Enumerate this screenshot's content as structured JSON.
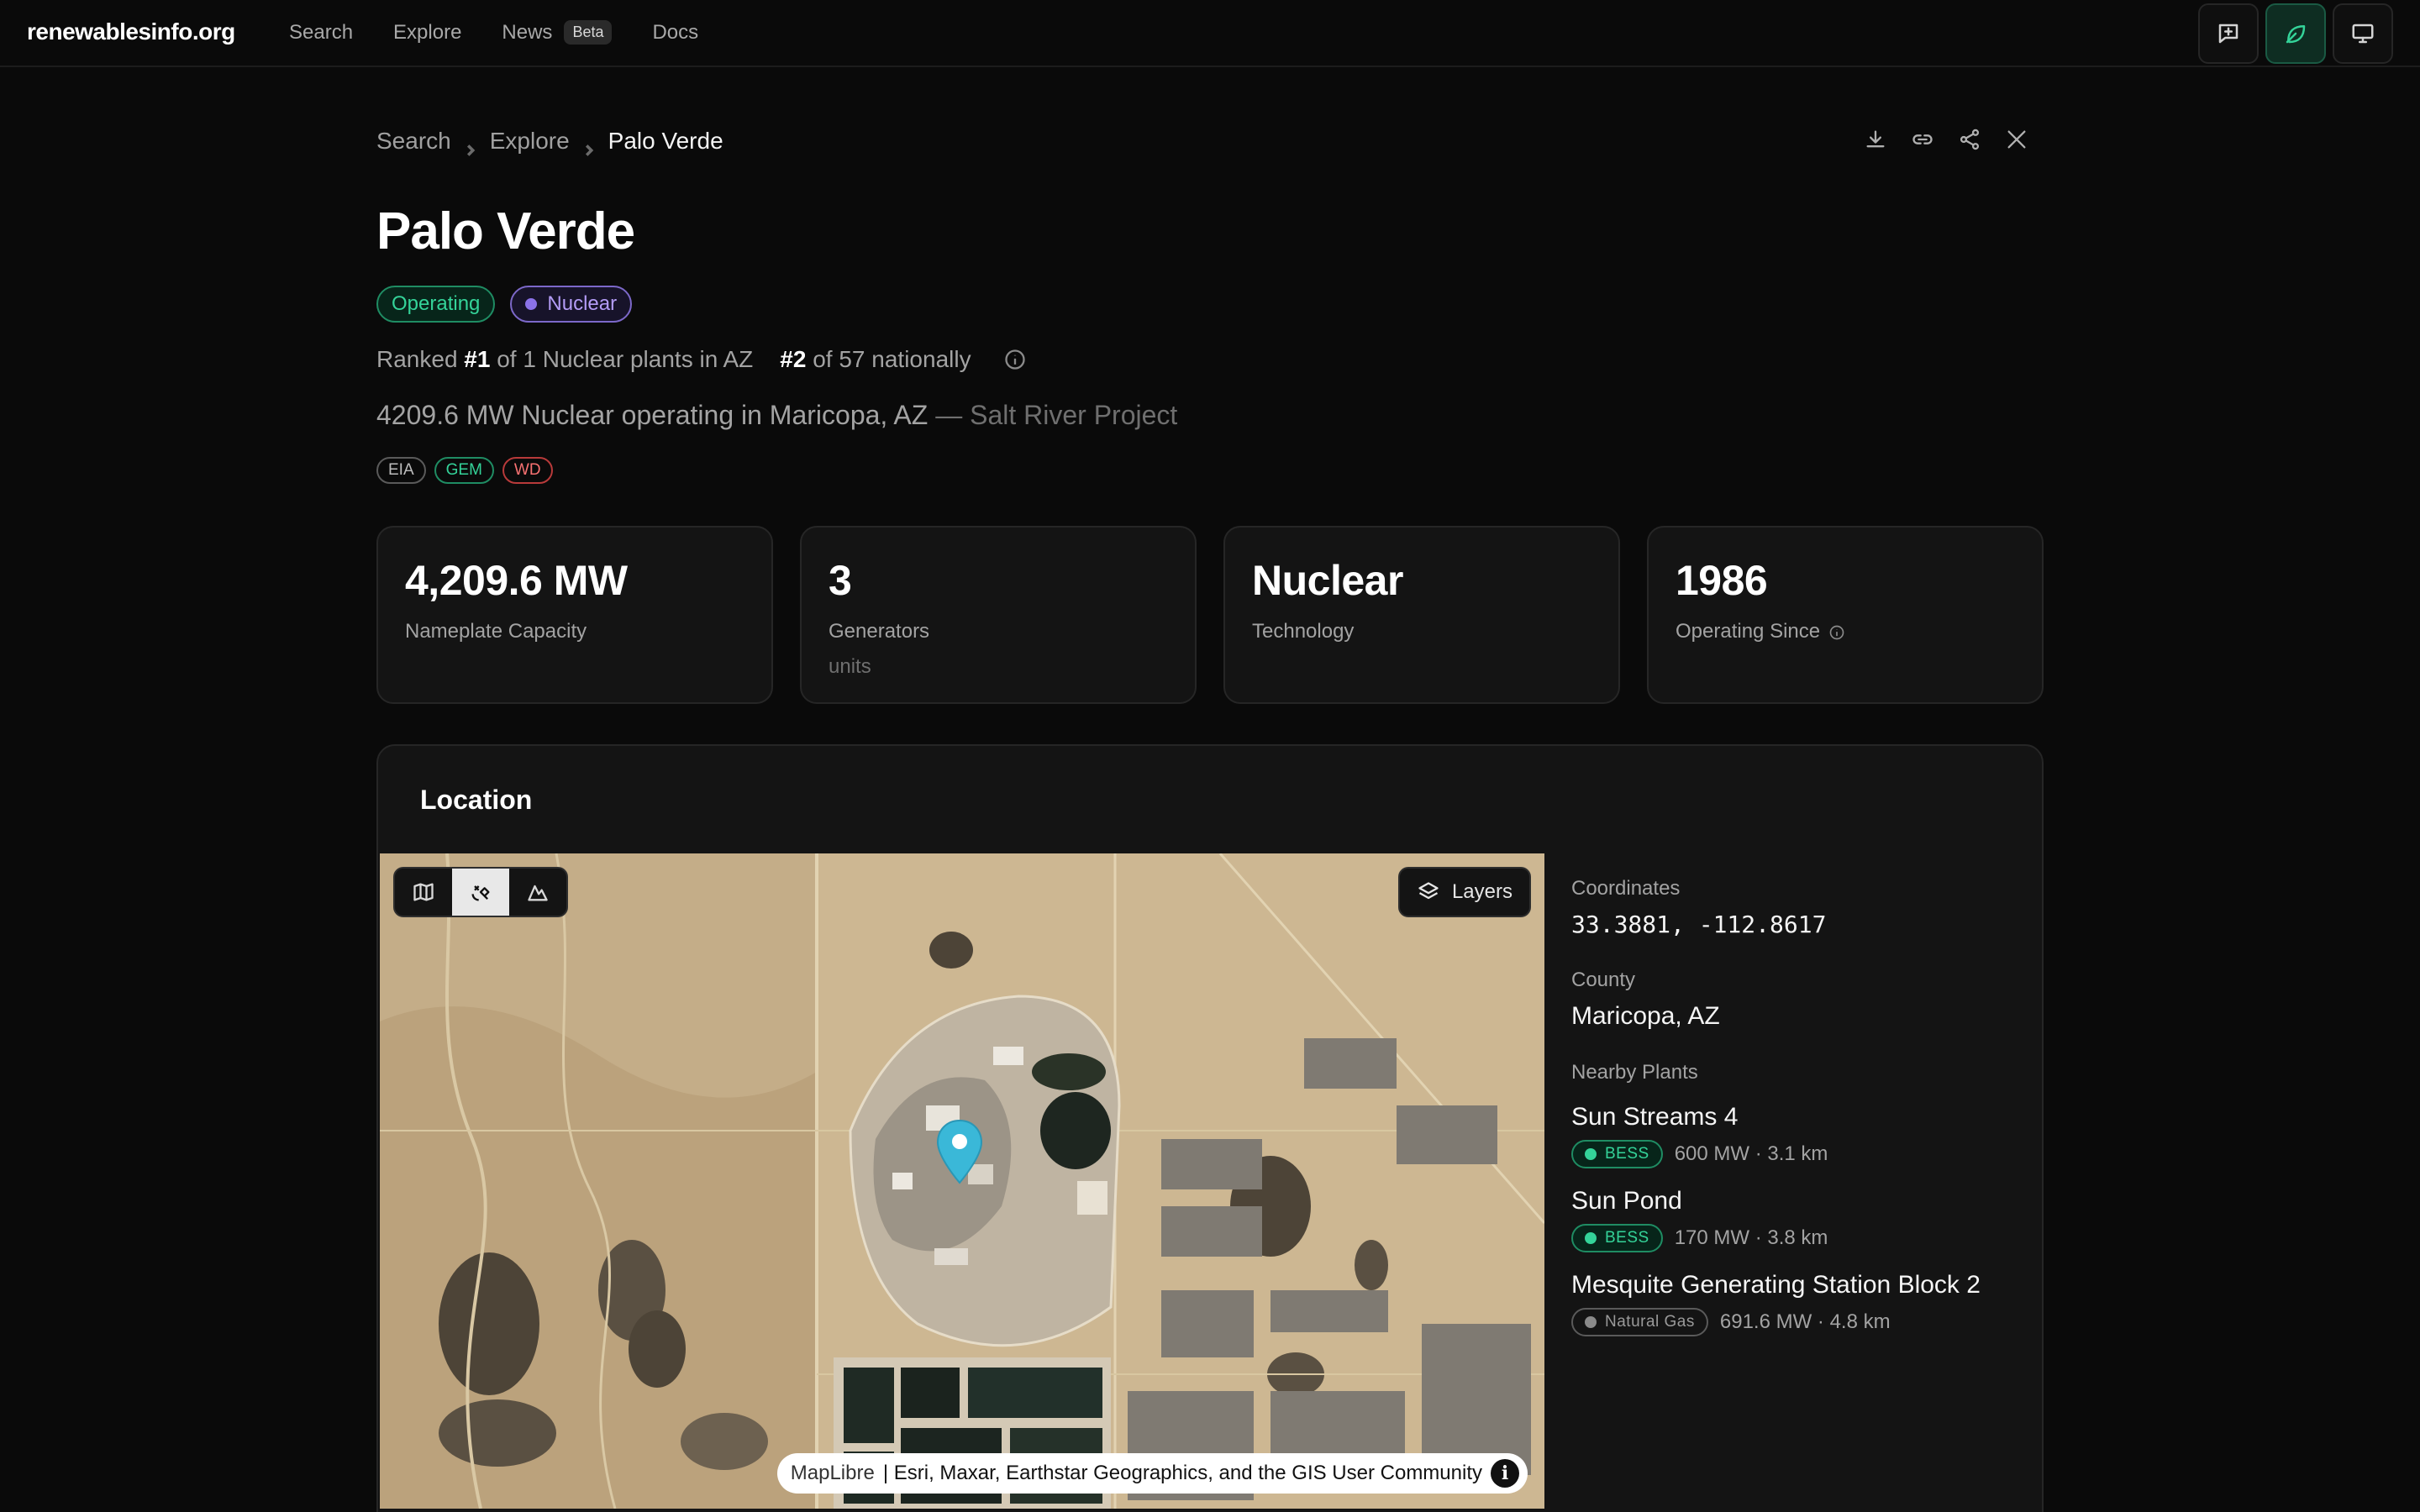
{
  "nav": {
    "brand": "renewablesinfo.org",
    "links": [
      {
        "label": "Search"
      },
      {
        "label": "Explore"
      },
      {
        "label": "News",
        "badge": "Beta"
      },
      {
        "label": "Docs"
      }
    ],
    "icons": [
      "feedback-icon",
      "leaf-icon",
      "monitor-icon"
    ]
  },
  "breadcrumb": {
    "items": [
      "Search",
      "Explore"
    ],
    "current": "Palo Verde"
  },
  "plant": {
    "name": "Palo Verde",
    "status": "Operating",
    "technology_tag": "Nuclear",
    "rank": {
      "prefix": "Ranked",
      "state_rank": "#1",
      "state_text": "of 1 Nuclear plants in AZ",
      "national_rank": "#2",
      "national_text": "of 57 nationally"
    },
    "summary": "4209.6 MW Nuclear operating in Maricopa, AZ",
    "owner": "— Salt River Project",
    "sources": [
      "EIA",
      "GEM",
      "WD"
    ]
  },
  "stats": [
    {
      "value": "4,209.6 MW",
      "label": "Nameplate Capacity"
    },
    {
      "value": "3",
      "label": "Generators",
      "sub": "units"
    },
    {
      "value": "Nuclear",
      "label": "Technology"
    },
    {
      "value": "1986",
      "label": "Operating Since"
    }
  ],
  "location": {
    "title": "Location",
    "layers_label": "Layers",
    "attribution": {
      "maplibre": "MapLibre",
      "text": "| Esri, Maxar, Earthstar Geographics, and the GIS User Community",
      "info": "i"
    },
    "coordinates_label": "Coordinates",
    "coordinates": "33.3881, -112.8617",
    "county_label": "County",
    "county": "Maricopa, AZ",
    "nearby_label": "Nearby Plants",
    "nearby": [
      {
        "name": "Sun Streams 4",
        "tag": "BESS",
        "meta": "600 MW · 3.1 km"
      },
      {
        "name": "Sun Pond",
        "tag": "BESS",
        "meta": "170 MW · 3.8 km"
      },
      {
        "name": "Mesquite Generating Station Block 2",
        "tag": "Natural Gas",
        "meta": "691.6 MW · 4.8 km"
      }
    ]
  },
  "colors": {
    "accent_green": "#34d399",
    "nuclear_purple": "#8b72e8",
    "marker_blue": "#3ab8d8",
    "background": "#0a0a0a",
    "card": "#141414"
  }
}
